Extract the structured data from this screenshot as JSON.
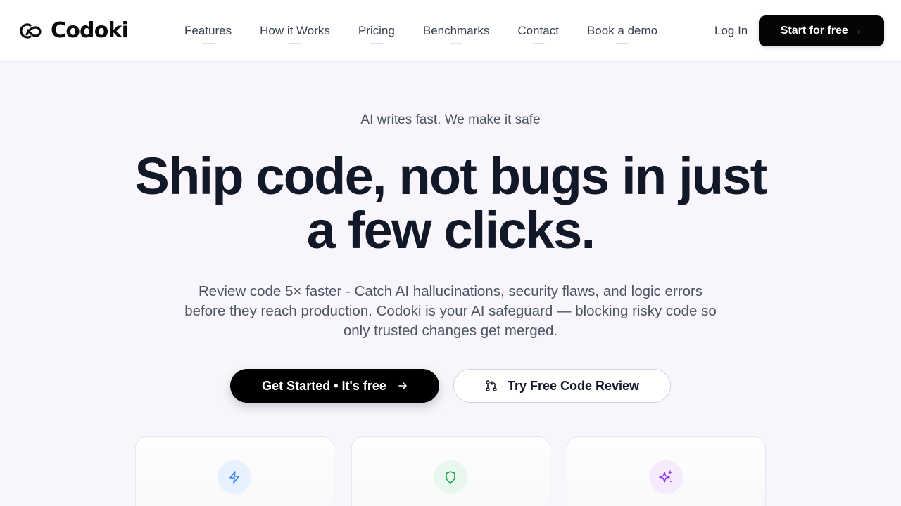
{
  "header": {
    "brand": "Codoki",
    "nav": [
      "Features",
      "How it Works",
      "Pricing",
      "Benchmarks",
      "Contact",
      "Book a demo"
    ],
    "login_label": "Log In",
    "cta_label": "Start for free →"
  },
  "hero": {
    "tagline": "AI writes fast. We make it safe",
    "headline_line1": "Ship code, not bugs in just",
    "headline_line2": "a few clicks.",
    "subtext": "Review code 5× faster - Catch AI hallucinations, security flaws, and logic errors before they reach production. Codoki is your AI safeguard — blocking risky code so only trusted changes get merged.",
    "primary_button": "Get Started • It's free",
    "secondary_button": "Try Free Code Review"
  },
  "cards": [
    {
      "icon": "lightning-icon",
      "color": "#3b82f6",
      "bg": "#e8f1fe"
    },
    {
      "icon": "shield-icon",
      "color": "#16a34a",
      "bg": "#e9f8ee"
    },
    {
      "icon": "sparkles-icon",
      "color": "#9333ea",
      "bg": "#f5ebfd"
    }
  ],
  "colors": {
    "accent": "#000000",
    "background": "#f8f6fc",
    "text": "#111827",
    "muted_text": "#4b5563"
  }
}
